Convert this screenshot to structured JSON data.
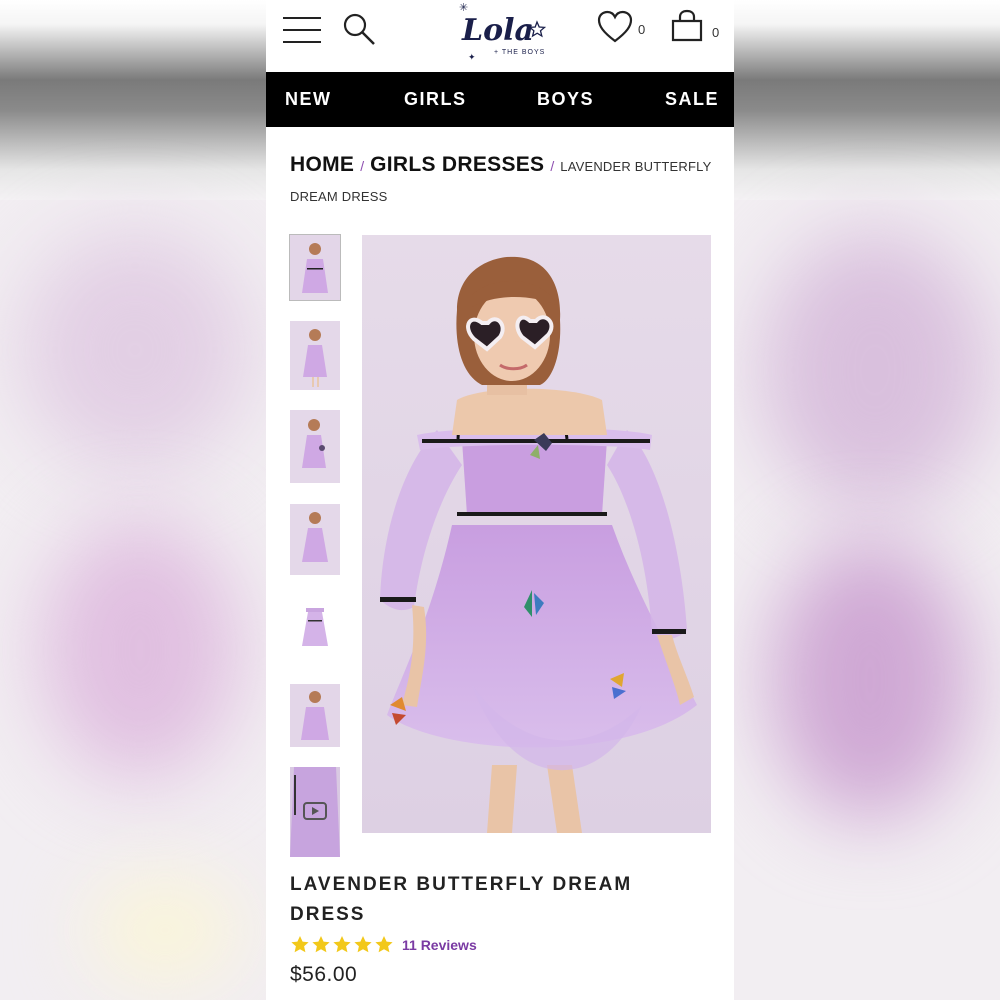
{
  "header": {
    "brand_name": "Lola",
    "brand_tagline": "+ THE BOYS",
    "wishlist_count": "0",
    "cart_count": "0"
  },
  "nav": {
    "items": [
      {
        "label": "NEW"
      },
      {
        "label": "GIRLS"
      },
      {
        "label": "BOYS"
      },
      {
        "label": "SALE"
      }
    ]
  },
  "breadcrumb": {
    "home": "HOME",
    "category": "GIRLS DRESSES",
    "current": "LAVENDER BUTTERFLY DREAM DRESS",
    "separator": "/"
  },
  "gallery": {
    "thumbnail_count": 7,
    "video_thumbnail_icon": "play-icon"
  },
  "product": {
    "title": "LAVENDER BUTTERFLY DREAM DRESS",
    "rating": 5,
    "reviews_label": "11 Reviews",
    "price": "$56.00"
  },
  "colors": {
    "nav_background": "#000000",
    "accent_purple": "#7a3aa3",
    "star_yellow": "#f2c81a",
    "dress_lavender": "#cdaee6"
  }
}
